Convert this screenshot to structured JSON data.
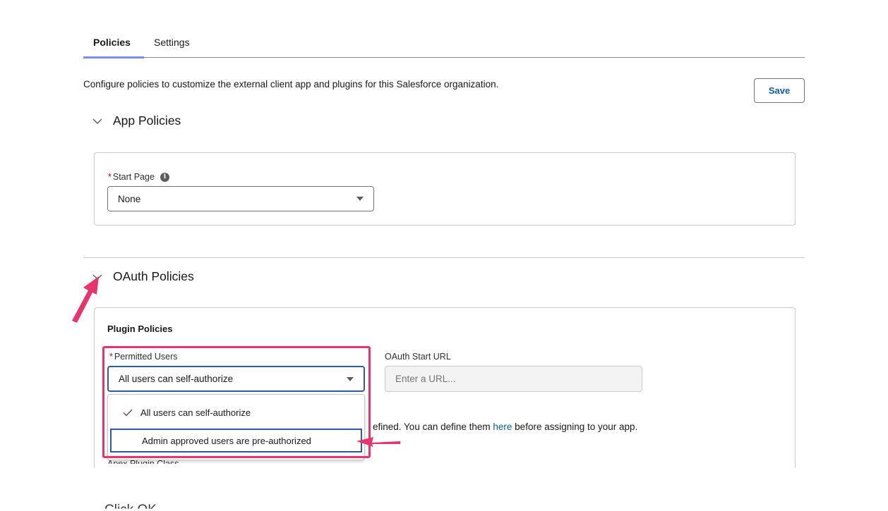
{
  "tabs": [
    {
      "label": "Policies",
      "active": true
    },
    {
      "label": "Settings",
      "active": false
    }
  ],
  "description": "Configure policies to customize the external client app and plugins for this Salesforce organization.",
  "save_label": "Save",
  "app_policies": {
    "title": "App Policies",
    "start_page": {
      "required_mark": "*",
      "label": "Start Page",
      "info_icon": "i",
      "value": "None"
    }
  },
  "oauth_policies": {
    "title": "OAuth Policies",
    "plugin_policies": {
      "title": "Plugin Policies",
      "permitted_users": {
        "required_mark": "*",
        "label": "Permitted Users",
        "value": "All users can self-authorize",
        "options": [
          {
            "label": "All users can self-authorize",
            "selected": true
          },
          {
            "label": "Admin approved users are pre-authorized",
            "selected": false
          }
        ]
      },
      "oauth_start_url": {
        "label": "OAuth Start URL",
        "placeholder": "Enter a URL..."
      },
      "note_text": "efined. You can define them ",
      "note_link": "here",
      "note_tail": " before assigning to your app.",
      "apex_label": "Apex Plugin Class"
    }
  },
  "caption": "Click OK",
  "colors": {
    "accent": "#e8336d",
    "link": "#0b5cab",
    "focus": "#2e59a8",
    "tab_underline": "#7b8ef0"
  }
}
